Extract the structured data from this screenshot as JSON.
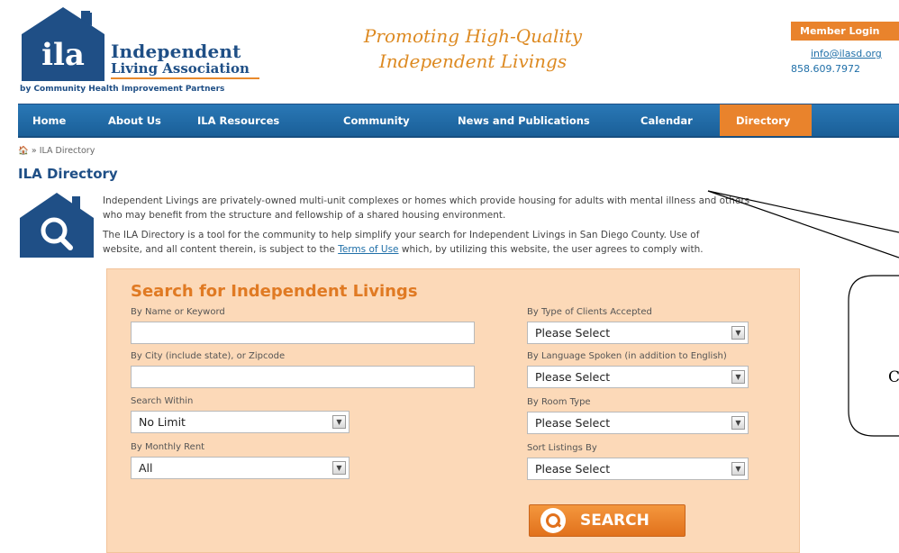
{
  "header": {
    "logo_mark": "ila",
    "org_line1": "Independent",
    "org_line2": "Living Association",
    "org_byline": "by Community Health Improvement Partners",
    "tagline_line1": "Promoting High-Quality",
    "tagline_line2": "Independent Livings",
    "member_login": "Member Login",
    "email": "info@ilasd.org",
    "phone": "858.609.7972"
  },
  "nav": {
    "items": [
      {
        "label": "Home"
      },
      {
        "label": "About Us"
      },
      {
        "label": "ILA Resources"
      },
      {
        "label": "Community"
      },
      {
        "label": "News and Publications"
      },
      {
        "label": "Calendar"
      },
      {
        "label": "Directory"
      }
    ],
    "active_index": 6
  },
  "breadcrumb": {
    "separator": "»",
    "current": "ILA Directory"
  },
  "page_title": "ILA Directory",
  "intro": {
    "p1_line1": "Independent Livings are privately-owned multi-unit complexes or homes which provide housing for adults with mental illness and others",
    "p1_line2": "who may benefit from the structure and fellowship of a shared housing environment.",
    "p2_line1": "The ILA Directory is a tool for the community to help simplify your search for Independent Livings in San Diego County.  Use of",
    "p2_line2_before": "website, and all content therein, is subject to the ",
    "p2_link": "Terms of Use",
    "p2_line2_after": " which, by utilizing this website, the user agrees to comply with."
  },
  "search": {
    "heading": "Search for Independent Livings",
    "name_label": "By Name or Keyword",
    "name_value": "",
    "city_label": "By City (include state), or Zipcode",
    "city_value": "",
    "within_label": "Search Within",
    "within_value": "No Limit",
    "rent_label": "By Monthly Rent",
    "rent_value": "All",
    "clients_label": "By Type of Clients Accepted",
    "clients_value": "Please Select",
    "language_label": "By Language Spoken (in addition to English)",
    "language_value": "Please Select",
    "room_label": "By Room Type",
    "room_value": "Please Select",
    "sort_label": "Sort Listings By",
    "sort_value": "Please Select",
    "button_label": "SEARCH"
  },
  "callout": {
    "text": "C"
  },
  "colors": {
    "brand_blue": "#1f4f86",
    "nav_blue": "#2a78b6",
    "accent_orange": "#e9832c",
    "panel_peach": "#fcd9b8"
  }
}
